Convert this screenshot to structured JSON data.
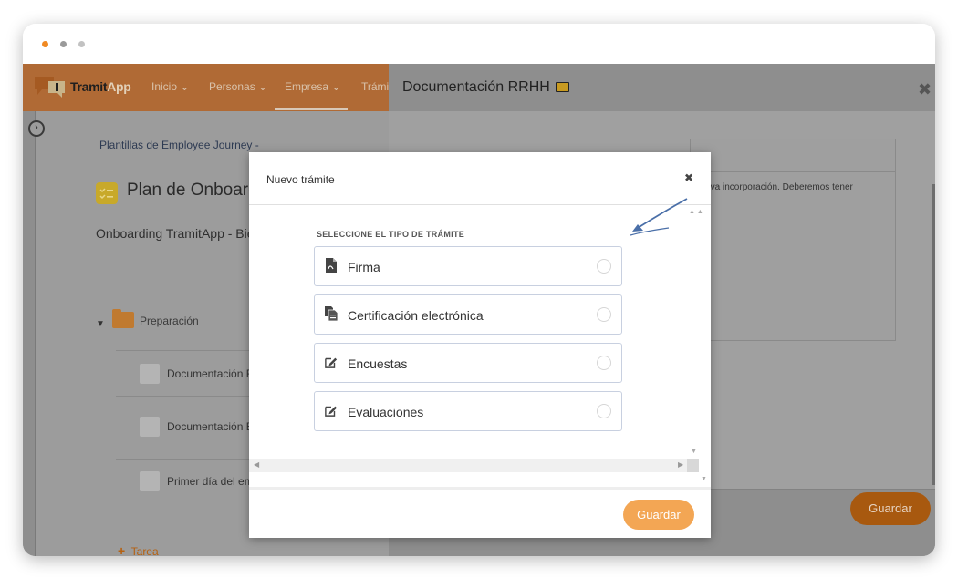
{
  "colors": {
    "brand_orange": "#f08a24",
    "save_button": "#f3a654",
    "window_dot_1": "#f08a24",
    "window_dot_2": "#9a9a9a",
    "window_dot_3": "#c2c2c2",
    "annotation_arrow": "#4a6fa8"
  },
  "app": {
    "logo_tramit": "Tramit",
    "logo_app": "App"
  },
  "nav": {
    "items": [
      "Inicio",
      "Personas",
      "Empresa",
      "Trámit"
    ]
  },
  "breadcrumb": "Plantillas de Employee Journey -",
  "plan": {
    "title": "Plan de Onboardi",
    "subtitle": "Onboarding TramitApp - Bier"
  },
  "section": {
    "label": "Preparación",
    "tasks": [
      "Documentación R",
      "Documentación E",
      "Primer día del em"
    ],
    "add_task": "Tarea"
  },
  "right_panel": {
    "title": "Documentación RRHH",
    "description": "nueva incorporación. Deberemos tener",
    "save_label": "Guardar"
  },
  "modal": {
    "title": "Nuevo trámite",
    "select_label": "SELECCIONE EL TIPO DE TRÁMITE",
    "options": [
      {
        "label": "Firma",
        "icon": "pdf-document-icon"
      },
      {
        "label": "Certificación electrónica",
        "icon": "certificate-documents-icon"
      },
      {
        "label": "Encuestas",
        "icon": "edit-survey-icon"
      },
      {
        "label": "Evaluaciones",
        "icon": "edit-evaluation-icon"
      }
    ],
    "save_label": "Guardar"
  }
}
